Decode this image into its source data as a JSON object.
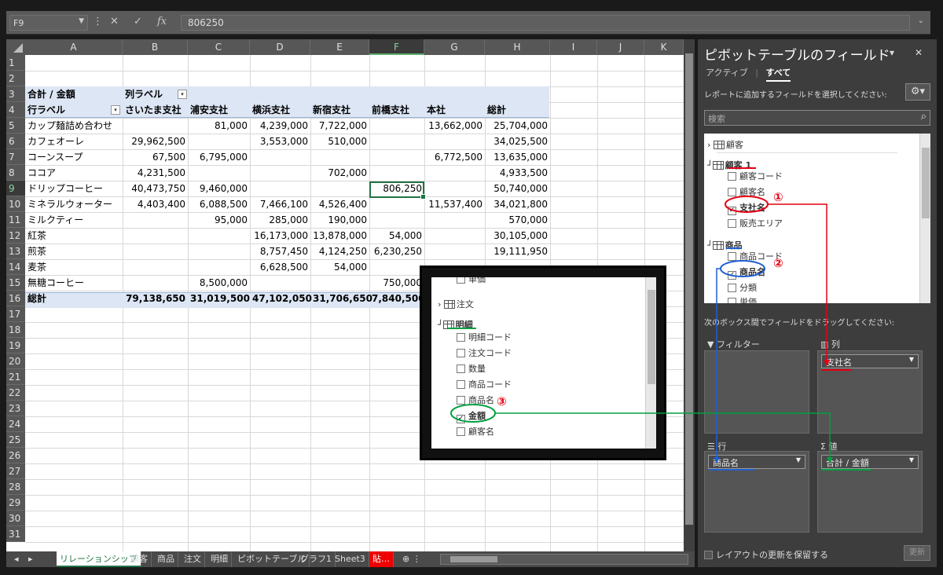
{
  "formula_bar": {
    "cell_ref": "F9",
    "value": "806250",
    "icons": [
      "cancel-icon",
      "enter-icon",
      "function-icon"
    ],
    "fx": "fx"
  },
  "columns": [
    "A",
    "B",
    "C",
    "D",
    "E",
    "F",
    "G",
    "H",
    "I",
    "J",
    "K"
  ],
  "selected": {
    "col": "F",
    "row": "9"
  },
  "rows": [
    "1",
    "2",
    "3",
    "4",
    "5",
    "6",
    "7",
    "8",
    "9",
    "10",
    "11",
    "12",
    "13",
    "14",
    "15",
    "16",
    "17",
    "18",
    "19",
    "20",
    "21",
    "22",
    "23",
    "24",
    "25",
    "26",
    "27",
    "28",
    "29",
    "30",
    "31"
  ],
  "pivot": {
    "sum_label": "合計 / 金額",
    "col_label": "列ラベル",
    "row_label": "行ラベル",
    "col_headers": [
      "さいたま支社",
      "浦安支社",
      "横浜支社",
      "新宿支社",
      "前橋支社",
      "本社",
      "総計"
    ],
    "body": [
      [
        "カップ麺詰め合わせ",
        "",
        "81,000",
        "4,239,000",
        "7,722,000",
        "",
        "13,662,000",
        "25,704,000"
      ],
      [
        "カフェオーレ",
        "29,962,500",
        "",
        "3,553,000",
        "510,000",
        "",
        "",
        "34,025,500"
      ],
      [
        "コーンスープ",
        "67,500",
        "6,795,000",
        "",
        "",
        "",
        "6,772,500",
        "13,635,000"
      ],
      [
        "ココア",
        "4,231,500",
        "",
        "",
        "702,000",
        "",
        "",
        "4,933,500"
      ],
      [
        "ドリップコーヒー",
        "40,473,750",
        "9,460,000",
        "",
        "",
        "806,250",
        "",
        "50,740,000"
      ],
      [
        "ミネラルウォーター",
        "4,403,400",
        "6,088,500",
        "7,466,100",
        "4,526,400",
        "",
        "11,537,400",
        "34,021,800"
      ],
      [
        "ミルクティー",
        "",
        "95,000",
        "285,000",
        "190,000",
        "",
        "",
        "570,000"
      ],
      [
        "紅茶",
        "",
        "",
        "16,173,000",
        "13,878,000",
        "54,000",
        "",
        "30,105,000"
      ],
      [
        "煎茶",
        "",
        "",
        "8,757,450",
        "4,124,250",
        "6,230,250",
        "",
        "19,111,950"
      ],
      [
        "麦茶",
        "",
        "",
        "6,628,500",
        "54,000",
        "",
        "",
        ""
      ],
      [
        "無糖コーヒー",
        "",
        "8,500,000",
        "",
        "",
        "750,000",
        "",
        ""
      ]
    ],
    "total": [
      "総計",
      "79,138,650",
      "31,019,500",
      "47,102,050",
      "31,706,650",
      "7,840,500",
      "",
      ""
    ]
  },
  "sheet_tabs": [
    "リレーションシップ",
    "顧客",
    "商品",
    "注文",
    "明細",
    "ピボットテーブル",
    "グラフ1",
    "Sheet3",
    "貼…"
  ],
  "panel": {
    "title": "ピボットテーブルのフィールド",
    "tab_active": "アクティブ",
    "tab_all": "すべて",
    "instruction": "レポートに追加するフィールドを選択してください:",
    "search_placeholder": "検索",
    "tables": {
      "t1": "顧客",
      "t2": "顧客 1",
      "t3": "商品"
    },
    "fields_t2": [
      "顧客コード",
      "顧客名",
      "支社名",
      "販売エリア"
    ],
    "fields_t3": [
      "商品コード",
      "商品名",
      "分類",
      "単価"
    ],
    "drag_text": "次のボックス間でフィールドをドラッグしてください:",
    "areas": {
      "filter": "フィルター",
      "columns": "列",
      "rows": "行",
      "values": "値"
    },
    "chips": {
      "columns": "支社名",
      "rows": "商品名",
      "values": "合計 / 金額"
    },
    "defer": "レイアウトの更新を保留する",
    "update": "更新"
  },
  "inset": {
    "tables": {
      "order": "注文",
      "detail": "明細"
    },
    "top_field": "単価",
    "fields": [
      "明細コード",
      "注文コード",
      "数量",
      "商品コード",
      "商品名",
      "金額",
      "顧客名"
    ]
  },
  "annotations": {
    "n1": "①",
    "n2": "②",
    "n3": "③"
  },
  "colors": {
    "red": "#e60012",
    "blue": "#1f5fd0",
    "green": "#00a040"
  }
}
